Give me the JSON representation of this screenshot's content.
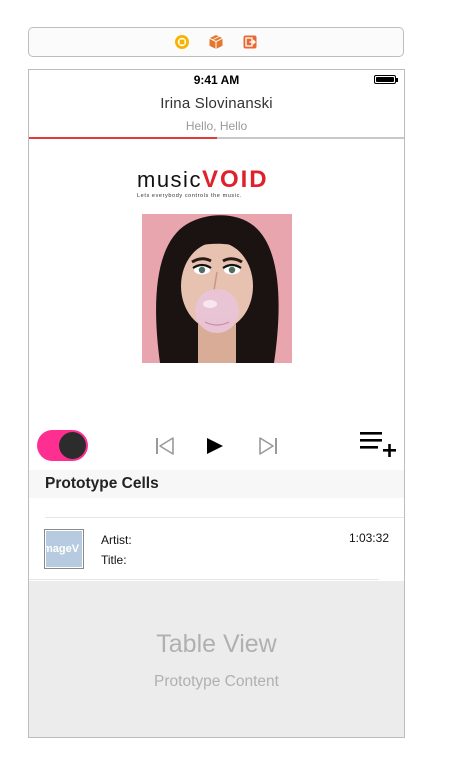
{
  "dock": {
    "icons": [
      "view-controller-icon",
      "first-responder-icon",
      "exit-icon"
    ],
    "colors": {
      "controller": "#f5b400",
      "responder": "#e3792f",
      "exit": "#e86a32"
    }
  },
  "status_bar": {
    "time": "9:41 AM",
    "battery": "full"
  },
  "nav": {
    "title": "Irina Slovinanski",
    "subtitle": "Hello, Hello",
    "progress_fraction": 0.5
  },
  "logo": {
    "word_music": "music",
    "word_void": "VOID",
    "tagline": "Lets everybody controls the music."
  },
  "album_art": {
    "description_icon": "album-cover-image"
  },
  "controls": {
    "toggle_on": true,
    "toggle_color": "#ff2f92",
    "icons": [
      "previous-icon",
      "play-icon",
      "next-icon",
      "add-to-playlist-icon"
    ]
  },
  "table": {
    "section_header": "Prototype Cells",
    "cell": {
      "thumbnail_text": "mageV",
      "artist_label": "Artist:",
      "title_label": "Title:",
      "duration": "1:03:32"
    },
    "placeholder_title": "Table View",
    "placeholder_subtitle": "Prototype Content"
  }
}
